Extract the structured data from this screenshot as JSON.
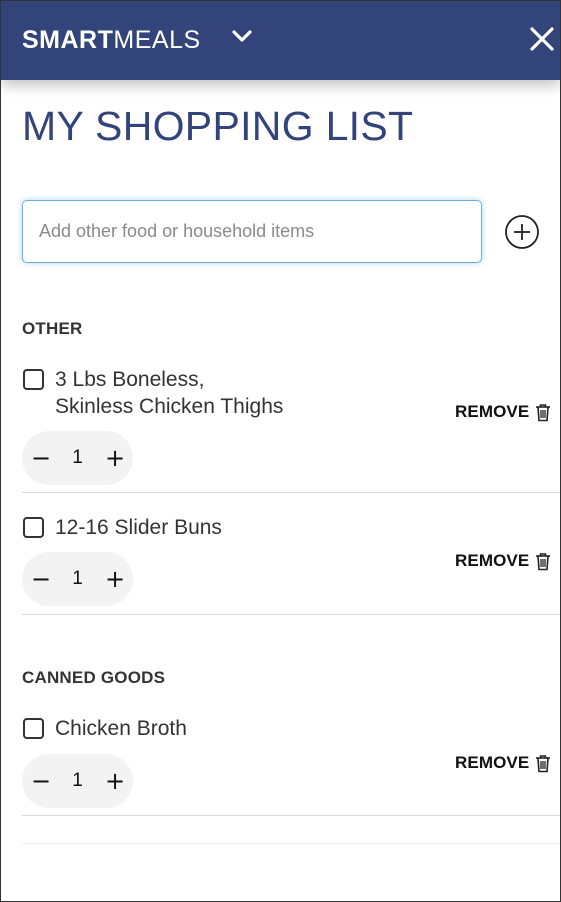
{
  "header": {
    "brand_bold": "SMART",
    "brand_light": "MEALS",
    "background_color": "#33447a"
  },
  "page": {
    "title": "MY SHOPPING LIST"
  },
  "search": {
    "placeholder": "Add other food or household items",
    "value": ""
  },
  "sections": [
    {
      "title": "OTHER",
      "items": [
        {
          "name_line1": "3 Lbs Boneless,",
          "name_line2": "Skinless Chicken Thighs",
          "quantity": "1",
          "checked": false,
          "remove_label": "REMOVE",
          "minus": "−",
          "plus": "+"
        },
        {
          "name_line1": "12-16 Slider Buns",
          "quantity": "1",
          "checked": false,
          "remove_label": "REMOVE",
          "minus": "−",
          "plus": "+"
        }
      ]
    },
    {
      "title": "CANNED GOODS",
      "items": [
        {
          "name_line1": "Chicken Broth",
          "quantity": "1",
          "checked": false,
          "remove_label": "REMOVE",
          "minus": "−",
          "plus": "+"
        }
      ]
    }
  ],
  "icons": {
    "dropdown": "chevron-down-icon",
    "close": "close-icon",
    "add": "plus-circle-icon",
    "remove": "trash-icon"
  }
}
